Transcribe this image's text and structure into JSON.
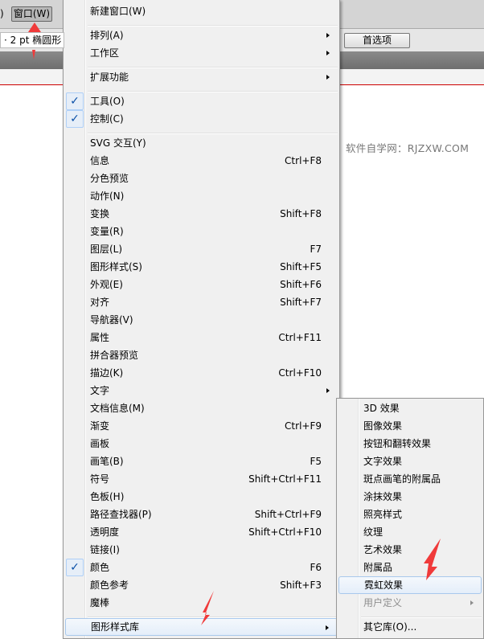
{
  "toolbar": {
    "paren": ")",
    "window_menu": "窗口(W)",
    "stroke": "·   2 pt  椭圆形",
    "preferences": "首选项",
    "watermark": "软件自学网：RJZXW.COM"
  },
  "menu": [
    {
      "label": "新建窗口(W)"
    },
    {
      "sep": true
    },
    {
      "label": "排列(A)",
      "sub": true
    },
    {
      "label": "工作区",
      "sub": true
    },
    {
      "sep": true
    },
    {
      "label": "扩展功能",
      "sub": true
    },
    {
      "sep": true
    },
    {
      "label": "工具(O)",
      "check": true
    },
    {
      "label": "控制(C)",
      "check": true
    },
    {
      "sep": true
    },
    {
      "label": "SVG 交互(Y)"
    },
    {
      "label": "信息",
      "sc": "Ctrl+F8"
    },
    {
      "label": "分色预览"
    },
    {
      "label": "动作(N)"
    },
    {
      "label": "变换",
      "sc": "Shift+F8"
    },
    {
      "label": "变量(R)"
    },
    {
      "label": "图层(L)",
      "sc": "F7"
    },
    {
      "label": "图形样式(S)",
      "sc": "Shift+F5"
    },
    {
      "label": "外观(E)",
      "sc": "Shift+F6"
    },
    {
      "label": "对齐",
      "sc": "Shift+F7"
    },
    {
      "label": "导航器(V)"
    },
    {
      "label": "属性",
      "sc": "Ctrl+F11"
    },
    {
      "label": "拼合器预览"
    },
    {
      "label": "描边(K)",
      "sc": "Ctrl+F10"
    },
    {
      "label": "文字",
      "sub": true
    },
    {
      "label": "文档信息(M)"
    },
    {
      "label": "渐变",
      "sc": "Ctrl+F9"
    },
    {
      "label": "画板"
    },
    {
      "label": "画笔(B)",
      "sc": "F5"
    },
    {
      "label": "符号",
      "sc": "Shift+Ctrl+F11"
    },
    {
      "label": "色板(H)"
    },
    {
      "label": "路径查找器(P)",
      "sc": "Shift+Ctrl+F9"
    },
    {
      "label": "透明度",
      "sc": "Shift+Ctrl+F10"
    },
    {
      "label": "链接(I)"
    },
    {
      "label": "颜色",
      "sc": "F6",
      "check": true
    },
    {
      "label": "颜色参考",
      "sc": "Shift+F3"
    },
    {
      "label": "魔棒"
    },
    {
      "sep": true
    },
    {
      "label": "图形样式库",
      "sub": true,
      "hl": true
    }
  ],
  "submenu": [
    {
      "label": "3D 效果"
    },
    {
      "label": "图像效果"
    },
    {
      "label": "按钮和翻转效果"
    },
    {
      "label": "文字效果"
    },
    {
      "label": "斑点画笔的附属品"
    },
    {
      "label": "涂抹效果"
    },
    {
      "label": "照亮样式"
    },
    {
      "label": "纹理"
    },
    {
      "label": "艺术效果"
    },
    {
      "label": "附属品"
    },
    {
      "label": "霓虹效果",
      "hl": true
    },
    {
      "label": "用户定义",
      "sub": true,
      "dis": true
    },
    {
      "sep": true
    },
    {
      "label": "其它库(O)..."
    }
  ],
  "check_glyph": "✓",
  "colors": {
    "arrow": "#f03a3a",
    "highlight": "#e4eefa"
  }
}
